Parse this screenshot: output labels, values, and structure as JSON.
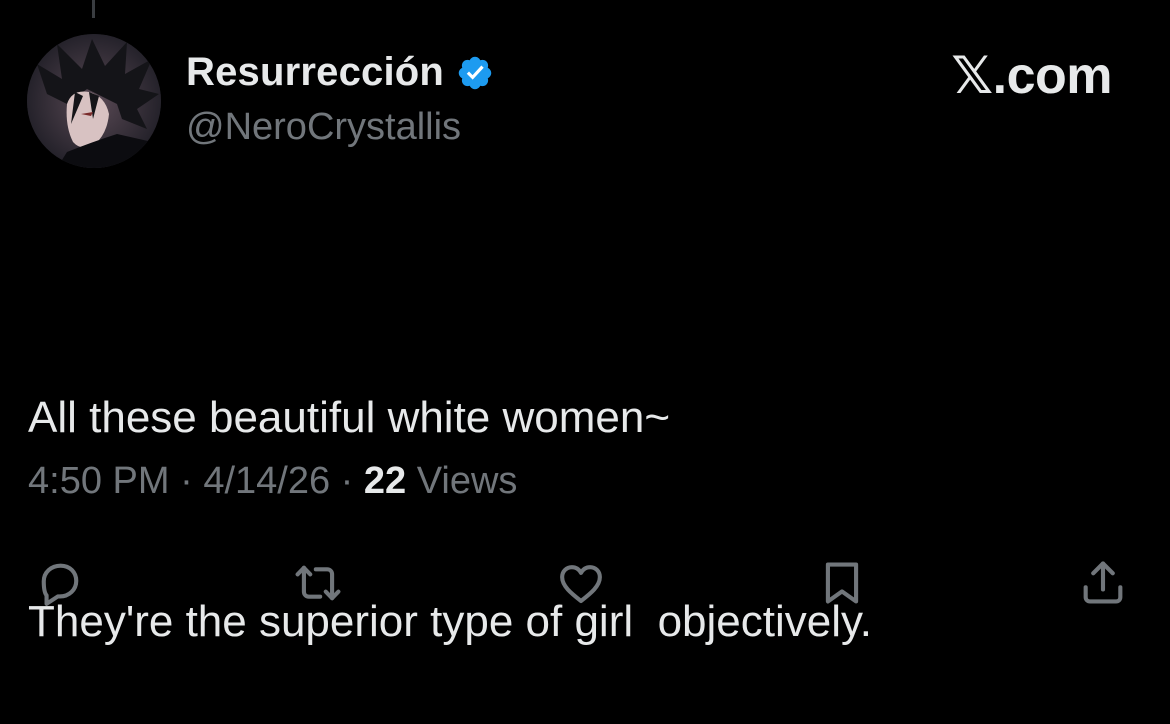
{
  "author": {
    "display_name": "Resurrección",
    "handle": "@NeroCrystallis",
    "verified": true,
    "avatar": "anime-character-avatar"
  },
  "brand": {
    "label": "𝕏.com"
  },
  "tweet": {
    "lines": [
      "All these beautiful white women~",
      "They're the superior type of girl  objectively."
    ]
  },
  "meta": {
    "time": "4:50 PM",
    "separator": " · ",
    "date": "4/14/26",
    "views_count": "22",
    "views_label": " Views"
  },
  "actions": [
    {
      "name": "reply",
      "icon": "reply-icon"
    },
    {
      "name": "repost",
      "icon": "repost-icon"
    },
    {
      "name": "like",
      "icon": "heart-icon"
    },
    {
      "name": "bookmark",
      "icon": "bookmark-icon"
    },
    {
      "name": "share",
      "icon": "share-icon"
    }
  ],
  "colors": {
    "background": "#000000",
    "primary_text": "#e7e9ea",
    "secondary_text": "#71767b",
    "verified_badge": "#1d9bf0"
  }
}
